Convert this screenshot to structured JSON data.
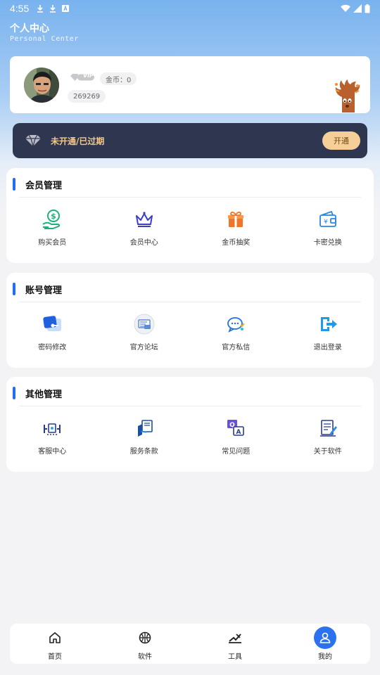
{
  "status_bar": {
    "time": "4:55"
  },
  "header": {
    "title": "个人中心",
    "subtitle": "Personal Center"
  },
  "profile": {
    "vip_text": "VIP",
    "coins_label": "金币：0",
    "user_id": "269269"
  },
  "vip_banner": {
    "status_text": "未开通/已过期",
    "open_button": "开通"
  },
  "sections": [
    {
      "title": "会员管理",
      "items": [
        {
          "label": "购买会员",
          "icon": "buy-vip-icon"
        },
        {
          "label": "会员中心",
          "icon": "crown-icon"
        },
        {
          "label": "金币抽奖",
          "icon": "gift-icon"
        },
        {
          "label": "卡密兑换",
          "icon": "wallet-icon"
        }
      ]
    },
    {
      "title": "账号管理",
      "items": [
        {
          "label": "密码修改",
          "icon": "key-card-icon"
        },
        {
          "label": "官方论坛",
          "icon": "forum-icon"
        },
        {
          "label": "官方私信",
          "icon": "chat-icon"
        },
        {
          "label": "退出登录",
          "icon": "logout-icon"
        }
      ]
    },
    {
      "title": "其他管理",
      "items": [
        {
          "label": "客服中心",
          "icon": "support-icon"
        },
        {
          "label": "服务条款",
          "icon": "terms-icon"
        },
        {
          "label": "常见问题",
          "icon": "faq-icon"
        },
        {
          "label": "关于软件",
          "icon": "about-icon"
        }
      ]
    }
  ],
  "tabbar": [
    {
      "label": "首页",
      "icon": "home-icon"
    },
    {
      "label": "软件",
      "icon": "basketball-icon"
    },
    {
      "label": "工具",
      "icon": "tools-icon"
    },
    {
      "label": "我的",
      "icon": "user-icon",
      "active": true
    }
  ],
  "colors": {
    "accent": "#2c72f0",
    "banner_bg": "#2f3650",
    "banner_text": "#f2c98a",
    "open_btn": "#f6cf98"
  }
}
